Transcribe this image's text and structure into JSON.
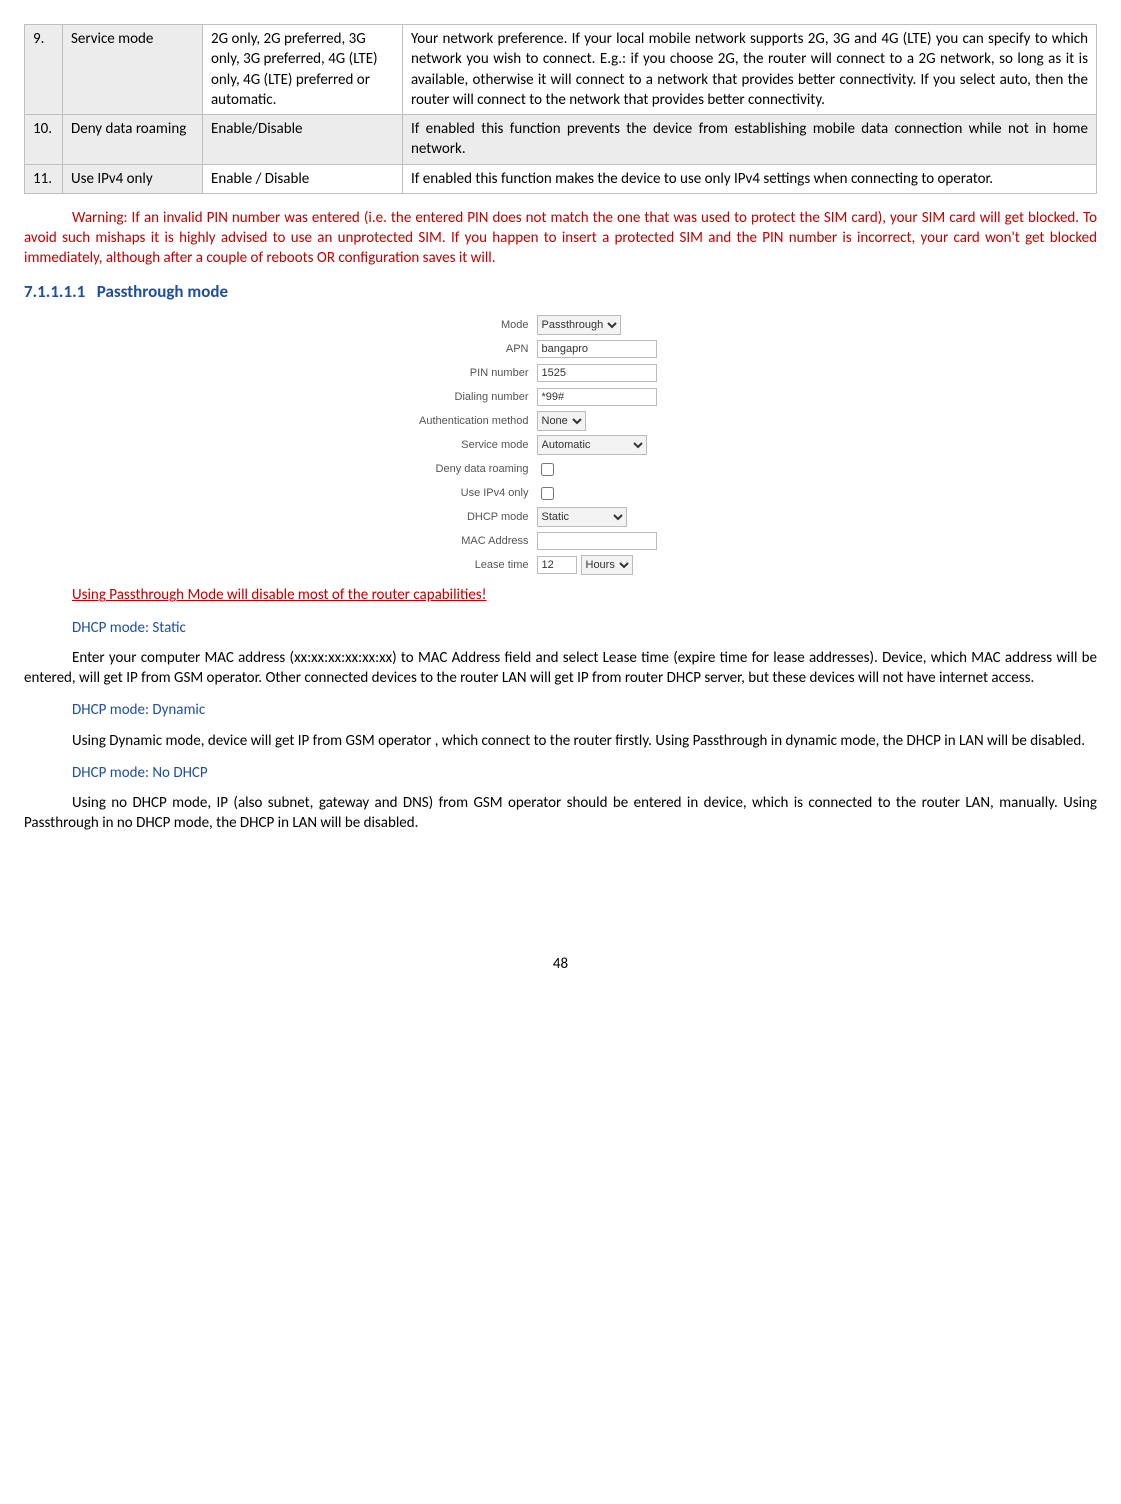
{
  "table": {
    "rows": [
      {
        "num": "9.",
        "name": "Service mode",
        "value": "2G only, 2G preferred, 3G only, 3G preferred, 4G (LTE) only, 4G (LTE) preferred or automatic.",
        "desc": "Your network preference. If your local mobile network supports 2G, 3G and 4G (LTE) you can specify to which network you wish to connect. E.g.: if you choose 2G, the router will connect to a 2G network, so long as it is available, otherwise it will connect to a network that provides better connectivity. If you select auto, then the router will connect to the network that provides better connectivity."
      },
      {
        "num": "10.",
        "name": "Deny data roaming",
        "value": "Enable/Disable",
        "desc": "If enabled this function prevents the device from establishing mobile data connection while not in home network."
      },
      {
        "num": "11.",
        "name": "Use IPv4 only",
        "value": "Enable / Disable",
        "desc": "If enabled this function makes the device to use only IPv4 settings when connecting to operator."
      }
    ]
  },
  "warning_text": "Warning: If an invalid PIN number was entered (i.e. the entered PIN does not match the one that was used to protect the SIM card), your SIM card will get blocked. To avoid such mishaps it is highly advised to use an unprotected SIM. If you happen to insert a protected SIM and the PIN number is incorrect, your card won't get blocked immediately, although after a couple of reboots OR configuration saves it will.",
  "section_number": "7.1.1.1.1",
  "section_title": "Passthrough mode",
  "form": {
    "mode": {
      "label": "Mode",
      "value": "Passthrough"
    },
    "apn": {
      "label": "APN",
      "value": "bangapro"
    },
    "pin": {
      "label": "PIN number",
      "value": "1525"
    },
    "dial": {
      "label": "Dialing number",
      "value": "*99#"
    },
    "auth": {
      "label": "Authentication method",
      "value": "None"
    },
    "service": {
      "label": "Service mode",
      "value": "Automatic"
    },
    "roaming": {
      "label": "Deny data roaming"
    },
    "ipv4": {
      "label": "Use IPv4 only"
    },
    "dhcp": {
      "label": "DHCP mode",
      "value": "Static"
    },
    "mac": {
      "label": "MAC Address",
      "value": ""
    },
    "lease": {
      "label": "Lease time",
      "value": "12",
      "unit": "Hours"
    }
  },
  "pass_warning": "Using Passthrough Mode will disable most of the router capabilities!",
  "dhcp_static_heading": "DHCP mode: Static",
  "dhcp_static_body": "Enter your computer MAC address (xx:xx:xx:xx:xx:xx) to MAC Address field and select Lease time (expire time for lease addresses). Device, which MAC address will be entered, will get IP from GSM operator. Other connected devices to the router LAN will get IP from router DHCP server, but these devices will not have internet access.",
  "dhcp_dynamic_heading": "DHCP mode: Dynamic",
  "dhcp_dynamic_body": "Using Dynamic mode, device will get IP from GSM operator , which connect to the router firstly. Using Passthrough in dynamic mode, the DHCP in LAN will be disabled.",
  "dhcp_nodhcp_heading": "DHCP mode: No DHCP",
  "dhcp_nodhcp_body": "Using no DHCP mode, IP (also subnet, gateway and DNS) from GSM operator should be entered in device, which is connected to the router LAN, manually. Using Passthrough in no DHCP mode, the DHCP in LAN will be disabled.",
  "page_number": "48"
}
